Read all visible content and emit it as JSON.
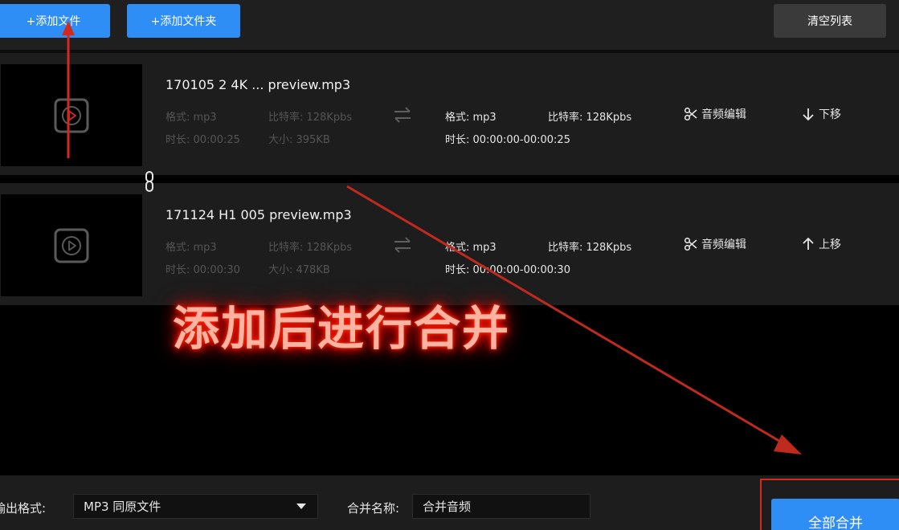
{
  "toolbar": {
    "add_file": "+添加文件",
    "add_folder": "+添加文件夹",
    "clear_list": "清空列表"
  },
  "files": [
    {
      "name": "170105 2 4K ... preview.mp3",
      "src_format": "格式: mp3",
      "src_bitrate": "比特率: 128Kpbs",
      "src_duration": "时长: 00:00:25",
      "src_size": "大小: 395KB",
      "out_format": "格式: mp3",
      "out_bitrate": "比特率: 128Kpbs",
      "out_duration": "时长: 00:00:00-00:00:25",
      "edit_label": "音频编辑",
      "move_label": "下移",
      "move_icon": "arrow-down-icon"
    },
    {
      "name": "171124 H1 005 preview.mp3",
      "src_format": "格式: mp3",
      "src_bitrate": "比特率: 128Kpbs",
      "src_duration": "时长: 00:00:30",
      "src_size": "大小: 478KB",
      "out_format": "格式: mp3",
      "out_bitrate": "比特率: 128Kpbs",
      "out_duration": "时长: 00:00:00-00:00:30",
      "edit_label": "音频编辑",
      "move_label": "上移",
      "move_icon": "arrow-up-icon"
    }
  ],
  "bottom": {
    "output_format_label": "输出格式:",
    "output_format_value": "MP3 同原文件",
    "merge_name_label": "合并名称:",
    "merge_name_value": "合并音频",
    "merge_all": "全部合并"
  },
  "annotation": {
    "text": "添加后进行合并"
  },
  "colors": {
    "accent_blue": "#2f8ef5",
    "annotation_red": "#d32a1e",
    "panel": "#1d1d1d",
    "background": "#000000"
  }
}
